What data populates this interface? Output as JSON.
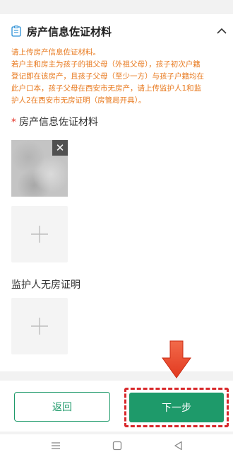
{
  "section": {
    "title": "房产信息佐证材料",
    "notice_lines": [
      "请上传房产信息佐证材料。",
      "若户主和房主为孩子的祖父母（外祖父母），孩子初次户籍",
      "登记即在该房产，且孩子父母（至少一方）与孩子户籍均在",
      "此户口本，孩子父母在西安市无房产，请上传监护人1和监",
      "护人2在西安市无房证明（房管局开具）。"
    ],
    "fields": [
      {
        "required": true,
        "required_mark": "*",
        "label": "房产信息佐证材料"
      },
      {
        "required": false,
        "label": "监护人无房证明"
      }
    ],
    "thumbnail_close": "✕"
  },
  "footer": {
    "back_label": "返回",
    "next_label": "下一步"
  },
  "colors": {
    "accent": "#1e9a6a",
    "notice": "#e8791e",
    "highlight": "#d8282b"
  },
  "icons": [
    "document-icon",
    "chevron-up-icon",
    "plus-icon",
    "close-icon",
    "down-arrow-icon",
    "menu-icon",
    "home-square-icon",
    "back-triangle-icon"
  ]
}
